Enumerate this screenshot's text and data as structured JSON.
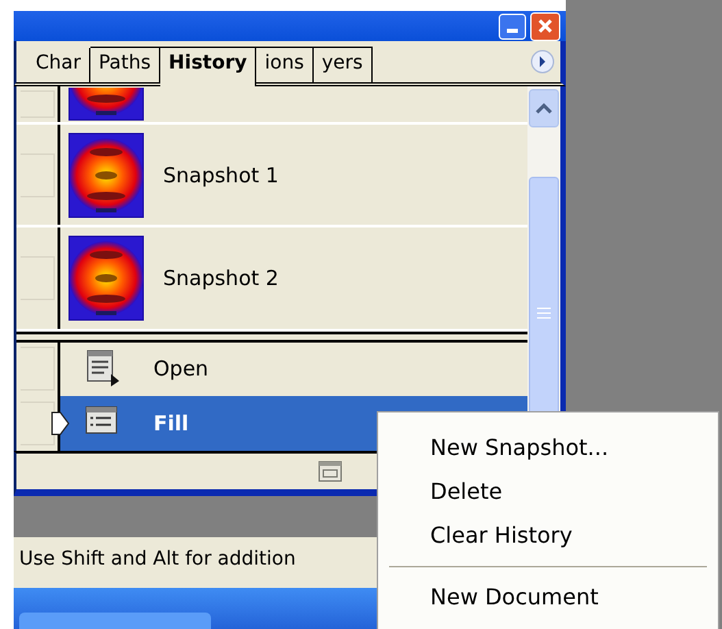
{
  "tabs": [
    {
      "label": "Char",
      "selected": false
    },
    {
      "label": "Paths",
      "selected": false
    },
    {
      "label": "History",
      "selected": true
    },
    {
      "label": "ions",
      "selected": false
    },
    {
      "label": "yers",
      "selected": false
    }
  ],
  "history": {
    "items": [
      {
        "kind": "snapshot",
        "selected": false
      },
      {
        "kind": "snapshot",
        "label": "Snapshot 1",
        "selected": false
      },
      {
        "kind": "snapshot",
        "label": "Snapshot 2",
        "selected": false
      },
      {
        "kind": "open",
        "label": "Open",
        "selected": false
      },
      {
        "kind": "fill",
        "label": "Fill",
        "selected": true
      }
    ]
  },
  "status_bar": {
    "text": "Use Shift and Alt for addition"
  },
  "context_menu": {
    "items": [
      {
        "kind": "item",
        "label": "New Snapshot..."
      },
      {
        "kind": "item",
        "label": "Delete"
      },
      {
        "kind": "item",
        "label": "Clear History"
      },
      {
        "kind": "separator"
      },
      {
        "kind": "item",
        "label": "New Document"
      }
    ]
  }
}
